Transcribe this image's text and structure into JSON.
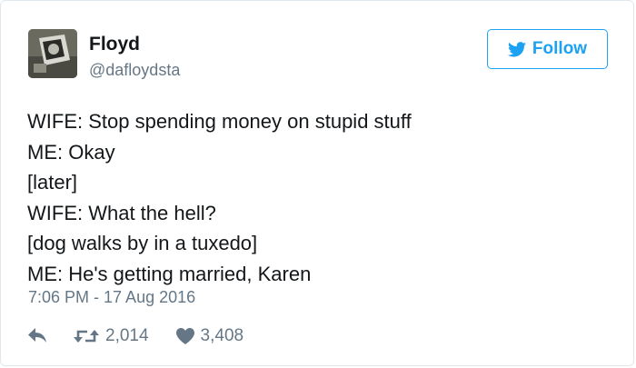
{
  "user": {
    "name": "Floyd",
    "handle": "@dafloydsta"
  },
  "follow_button": {
    "label": "Follow",
    "color": "#1da1f2"
  },
  "tweet": {
    "lines": [
      "WIFE: Stop spending money on stupid stuff",
      "ME: Okay",
      "[later]",
      "WIFE: What the hell?",
      "[dog walks by in a tuxedo]",
      "ME: He's getting married, Karen"
    ],
    "timestamp": "7:06 PM - 17 Aug 2016"
  },
  "actions": {
    "reply_icon": "reply-icon",
    "retweet_icon": "retweet-icon",
    "retweets": "2,014",
    "like_icon": "heart-icon",
    "likes": "3,408"
  }
}
